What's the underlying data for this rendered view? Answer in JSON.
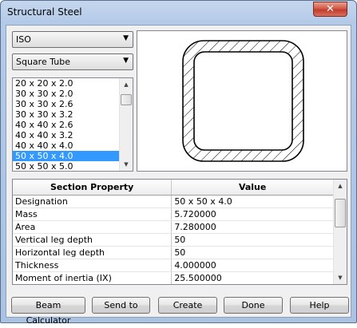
{
  "window": {
    "title": "Structural Steel",
    "close_glyph": "✕"
  },
  "standard_combo": {
    "selected": "ISO",
    "arrow_icon": "chevron-down-icon"
  },
  "shape_combo": {
    "selected": "Square Tube",
    "arrow_icon": "chevron-down-icon"
  },
  "sizes": {
    "items": [
      "20 x 20 x 2.0",
      "30 x 30 x 2.0",
      "30 x 30 x 2.6",
      "30 x 30 x 3.2",
      "40 x 40 x 2.6",
      "40 x 40 x 3.2",
      "40 x 40 x 4.0",
      "50 x 50 x 4.0",
      "50 x 50 x 5.0"
    ],
    "selected_index": 7
  },
  "properties": {
    "headers": [
      "Section Property",
      "Value"
    ],
    "rows": [
      [
        "Designation",
        "50 x 50 x 4.0"
      ],
      [
        "Mass",
        "5.720000"
      ],
      [
        "Area",
        "7.280000"
      ],
      [
        "Vertical leg depth",
        "50"
      ],
      [
        "Horizontal leg depth",
        "50"
      ],
      [
        "Thickness",
        "4.000000"
      ],
      [
        "Moment of inertia (IX)",
        "25.500000"
      ]
    ]
  },
  "buttons": {
    "beam_calculator": "Beam Calculator",
    "send_to": "Send to",
    "create": "Create",
    "done": "Done",
    "help": "Help"
  },
  "colors": {
    "selection": "#3399ff",
    "close": "#c13b2c"
  }
}
